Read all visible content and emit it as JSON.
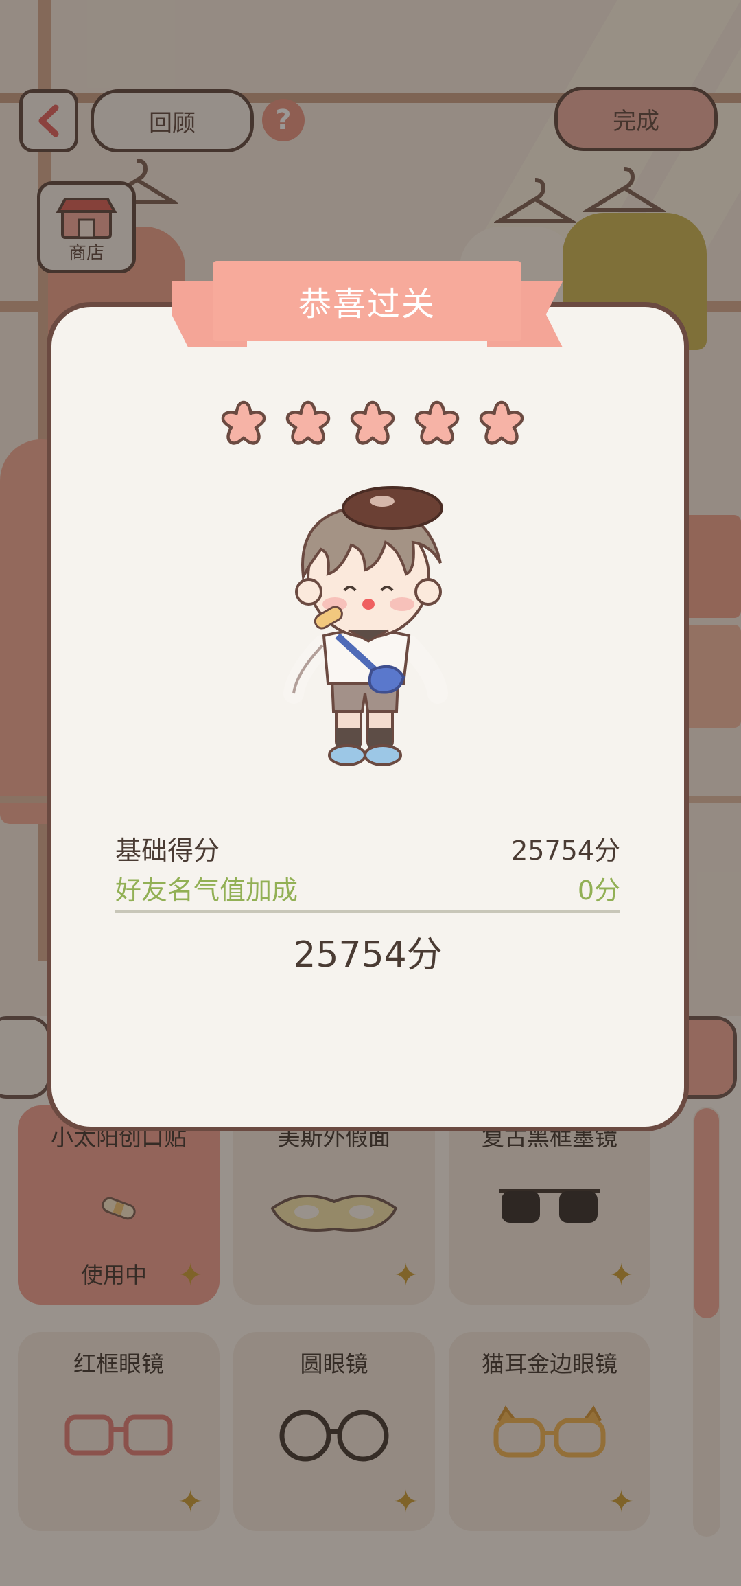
{
  "header": {
    "back_label": "<",
    "review_label": "回顾",
    "help_label": "?",
    "done_label": "完成"
  },
  "shop": {
    "label": "商店"
  },
  "dialog": {
    "title": "恭喜过关",
    "stars_filled": 5,
    "base_score_label": "基础得分",
    "base_score_value": "25754分",
    "bonus_label": "好友名气值加成",
    "bonus_value": "0分",
    "total_score": "25754分"
  },
  "items": [
    {
      "name": "小太阳创口贴",
      "status": "使用中",
      "selected": true,
      "icon": "bandage-icon"
    },
    {
      "name": "美斯外假面",
      "status": "",
      "selected": false,
      "icon": "mask-icon"
    },
    {
      "name": "复古黑框墨镜",
      "status": "",
      "selected": false,
      "icon": "sunglasses-icon"
    },
    {
      "name": "红框眼镜",
      "status": "",
      "selected": false,
      "icon": "red-glasses-icon"
    },
    {
      "name": "圆眼镜",
      "status": "",
      "selected": false,
      "icon": "round-glasses-icon"
    },
    {
      "name": "猫耳金边眼镜",
      "status": "",
      "selected": false,
      "icon": "cat-glasses-icon"
    }
  ],
  "colors": {
    "accent": "#f7aa9b",
    "bonus_text": "#92b055",
    "border": "#6b4a41"
  }
}
